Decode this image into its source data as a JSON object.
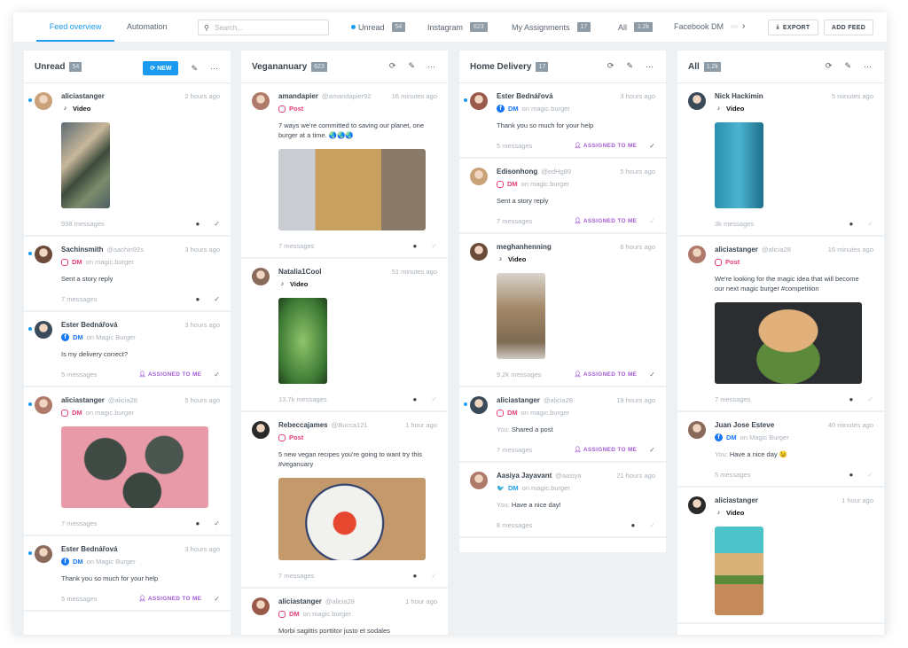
{
  "nav": {
    "tabs": [
      {
        "label": "Feed overview",
        "active": true
      },
      {
        "label": "Automation"
      }
    ],
    "search_placeholder": "Search...",
    "feed_tabs": [
      {
        "label": "Unread",
        "badge": "54",
        "dot": true
      },
      {
        "label": "Instagram",
        "badge": "623"
      },
      {
        "label": "My Assignments",
        "badge": "17"
      },
      {
        "label": "All",
        "badge": "1.2k"
      },
      {
        "label": "Facebook DM",
        "badge": ""
      }
    ],
    "export_label": "EXPORT",
    "add_feed_label": "ADD FEED"
  },
  "colors": {
    "accent": "#1a9bf0",
    "assigned": "#a35cd6",
    "instagram": "#e4407a",
    "facebook": "#1877f2",
    "twitter": "#1da1f2"
  },
  "columns": [
    {
      "title": "Unread",
      "badge": "54",
      "new_label": "NEW",
      "items": [
        {
          "unread": true,
          "name": "aliciastanger",
          "handle": "",
          "time": "2 hours ago",
          "channel": "tiktok",
          "type": "Video",
          "on": "",
          "image": "box",
          "messages": "938 messages",
          "assigned": false,
          "check": "dark"
        },
        {
          "unread": true,
          "name": "Sachinsmith",
          "handle": "@sachin92s",
          "time": "3 hours ago",
          "channel": "instagram",
          "type": "DM",
          "on": "on magic.burger",
          "text": "Sent a story reply",
          "messages": "7 messages",
          "assigned": false,
          "check": "dark"
        },
        {
          "unread": true,
          "name": "Ester Bednářová",
          "handle": "",
          "time": "3 hours ago",
          "channel": "facebook",
          "type": "DM",
          "on": "on Magic Burger",
          "text": "Is my delivery correct?",
          "messages": "5 messages",
          "assigned": true,
          "check": "dark"
        },
        {
          "unread": true,
          "name": "aliciastanger",
          "handle": "@alicia28",
          "time": "5 hours ago",
          "channel": "instagram",
          "type": "DM",
          "on": "on magic.burger",
          "image": "leaves",
          "messages": "7 messages",
          "assigned": false,
          "check": "dark"
        },
        {
          "unread": true,
          "name": "Ester Bednářová",
          "handle": "",
          "time": "3 hours ago",
          "channel": "facebook",
          "type": "DM",
          "on": "on Magic Burger",
          "text": "Thank you so much for your help",
          "messages": "5 messages",
          "assigned": true,
          "check": "dark"
        }
      ]
    },
    {
      "title": "Vegananuary",
      "badge": "623",
      "items": [
        {
          "name": "amandapier",
          "handle": "@amandapier92",
          "time": "16 minutes ago",
          "channel": "instagram",
          "type": "Post",
          "on": "",
          "text": "7 ways we're committed to saving our planet, one burger at a time. 🌏🌏🌏",
          "image": "earth",
          "messages": "7 messages",
          "assigned": false,
          "check": "faint"
        },
        {
          "name": "Natalia1Cool",
          "handle": "",
          "time": "51 minutes ago",
          "channel": "tiktok",
          "type": "Video",
          "on": "",
          "image": "leaf",
          "messages": "13,7k messages",
          "assigned": false,
          "check": "faint"
        },
        {
          "name": "Rebeccajames",
          "handle": "@Bucca121",
          "time": "1 hour ago",
          "channel": "instagram",
          "type": "Post",
          "on": "",
          "text": "5 new vegan recipes you're going to want try this #veganuary",
          "image": "plate",
          "messages": "7 messages",
          "assigned": false,
          "check": "faint"
        },
        {
          "name": "aliciastanger",
          "handle": "@alicia28",
          "time": "1 hour ago",
          "channel": "instagram",
          "type": "DM",
          "on": "on magic.burger",
          "text": "Morbi sagittis porttitor justo et sodales",
          "messages": "",
          "assigned": false,
          "check": "faint"
        }
      ]
    },
    {
      "title": "Home Delivery",
      "badge": "17",
      "items": [
        {
          "unread": true,
          "name": "Ester Bednářová",
          "handle": "",
          "time": "3 hours ago",
          "channel": "facebook",
          "type": "DM",
          "on": "on magic.burger",
          "text": "Thank you so much for your help",
          "messages": "5 messages",
          "assigned": true,
          "check": "dark"
        },
        {
          "name": "Edisonhong",
          "handle": "@edHg89",
          "time": "5 hours ago",
          "channel": "instagram",
          "type": "DM",
          "on": "on magic.burger",
          "text": "Sent a story reply",
          "messages": "7 messages",
          "assigned": true,
          "check": "faint"
        },
        {
          "name": "meghanhenning",
          "handle": "",
          "time": "6 hours ago",
          "channel": "tiktok",
          "type": "Video",
          "on": "",
          "image": "bag",
          "messages": "9,2k messages",
          "assigned": true,
          "check": "dark"
        },
        {
          "unread": true,
          "name": "aliciastanger",
          "handle": "@alicia28",
          "time": "19 hours ago",
          "channel": "instagram",
          "type": "DM",
          "on": "on magic.burger",
          "you": "You:",
          "text": "Shared a post",
          "messages": "7 messages",
          "assigned": true,
          "check": "dark"
        },
        {
          "name": "Aasiya Jayavant",
          "handle": "@aasiya",
          "time": "21 hours ago",
          "channel": "twitter",
          "type": "DM",
          "on": "on magic.burger",
          "you": "You:",
          "text": "Have a nice day!",
          "messages": "8 messages",
          "assigned": false,
          "check": "faint"
        }
      ]
    },
    {
      "title": "All",
      "badge": "1.2k",
      "items": [
        {
          "name": "Nick Hackimin",
          "handle": "",
          "time": "5 minutes ago",
          "channel": "tiktok",
          "type": "Video",
          "on": "",
          "image": "carton",
          "messages": "3k messages",
          "assigned": false,
          "check": "faint"
        },
        {
          "name": "aliciastanger",
          "handle": "@alicia28",
          "time": "16 minutes ago",
          "channel": "instagram",
          "type": "Post",
          "on": "",
          "text": "We're looking for the magic idea that will become our next magic burger #competition",
          "image": "burger",
          "messages": "7 messages",
          "assigned": false,
          "check": "faint"
        },
        {
          "name": "Juan Jose Esteve",
          "handle": "",
          "time": "40 minutes ago",
          "channel": "facebook",
          "type": "DM",
          "on": "on Magic Burger",
          "you": "You:",
          "text": "Have a nice day 😉",
          "messages": "5 messages",
          "assigned": false,
          "check": "faint"
        },
        {
          "name": "aliciastanger",
          "handle": "",
          "time": "1 hour ago",
          "channel": "tiktok",
          "type": "Video",
          "on": "",
          "image": "sandwich",
          "messages": "",
          "assigned": false,
          "check": "faint"
        }
      ]
    }
  ],
  "assigned_label": "ASSIGNED TO ME"
}
